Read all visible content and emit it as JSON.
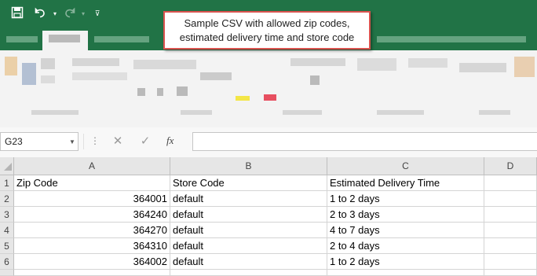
{
  "quick_access": {
    "icons": [
      "save-icon",
      "undo-icon",
      "redo-icon",
      "customize-icon"
    ]
  },
  "callout": {
    "line1": "Sample CSV with allowed zip codes,",
    "line2": "estimated delivery time and store code"
  },
  "formula_bar": {
    "name_box": "G23",
    "fx_label": "fx",
    "cancel_icon": "✕",
    "enter_icon": "✓",
    "formula": ""
  },
  "sheet": {
    "columns": [
      "A",
      "B",
      "C",
      "D"
    ],
    "row_numbers": [
      "1",
      "2",
      "3",
      "4",
      "5",
      "6"
    ],
    "header": [
      "Zip Code",
      "Store Code",
      "Estimated Delivery Time",
      ""
    ],
    "rows": [
      [
        "364001",
        "default",
        "1 to 2 days",
        ""
      ],
      [
        "364240",
        "default",
        "2 to 3 days",
        ""
      ],
      [
        "364270",
        "default",
        "4 to 7 days",
        ""
      ],
      [
        "364310",
        "default",
        "2 to 4 days",
        ""
      ],
      [
        "364002",
        "default",
        "1 to 2 days",
        ""
      ]
    ]
  },
  "colors": {
    "brand": "#217346",
    "callout_border": "#d9534f"
  }
}
